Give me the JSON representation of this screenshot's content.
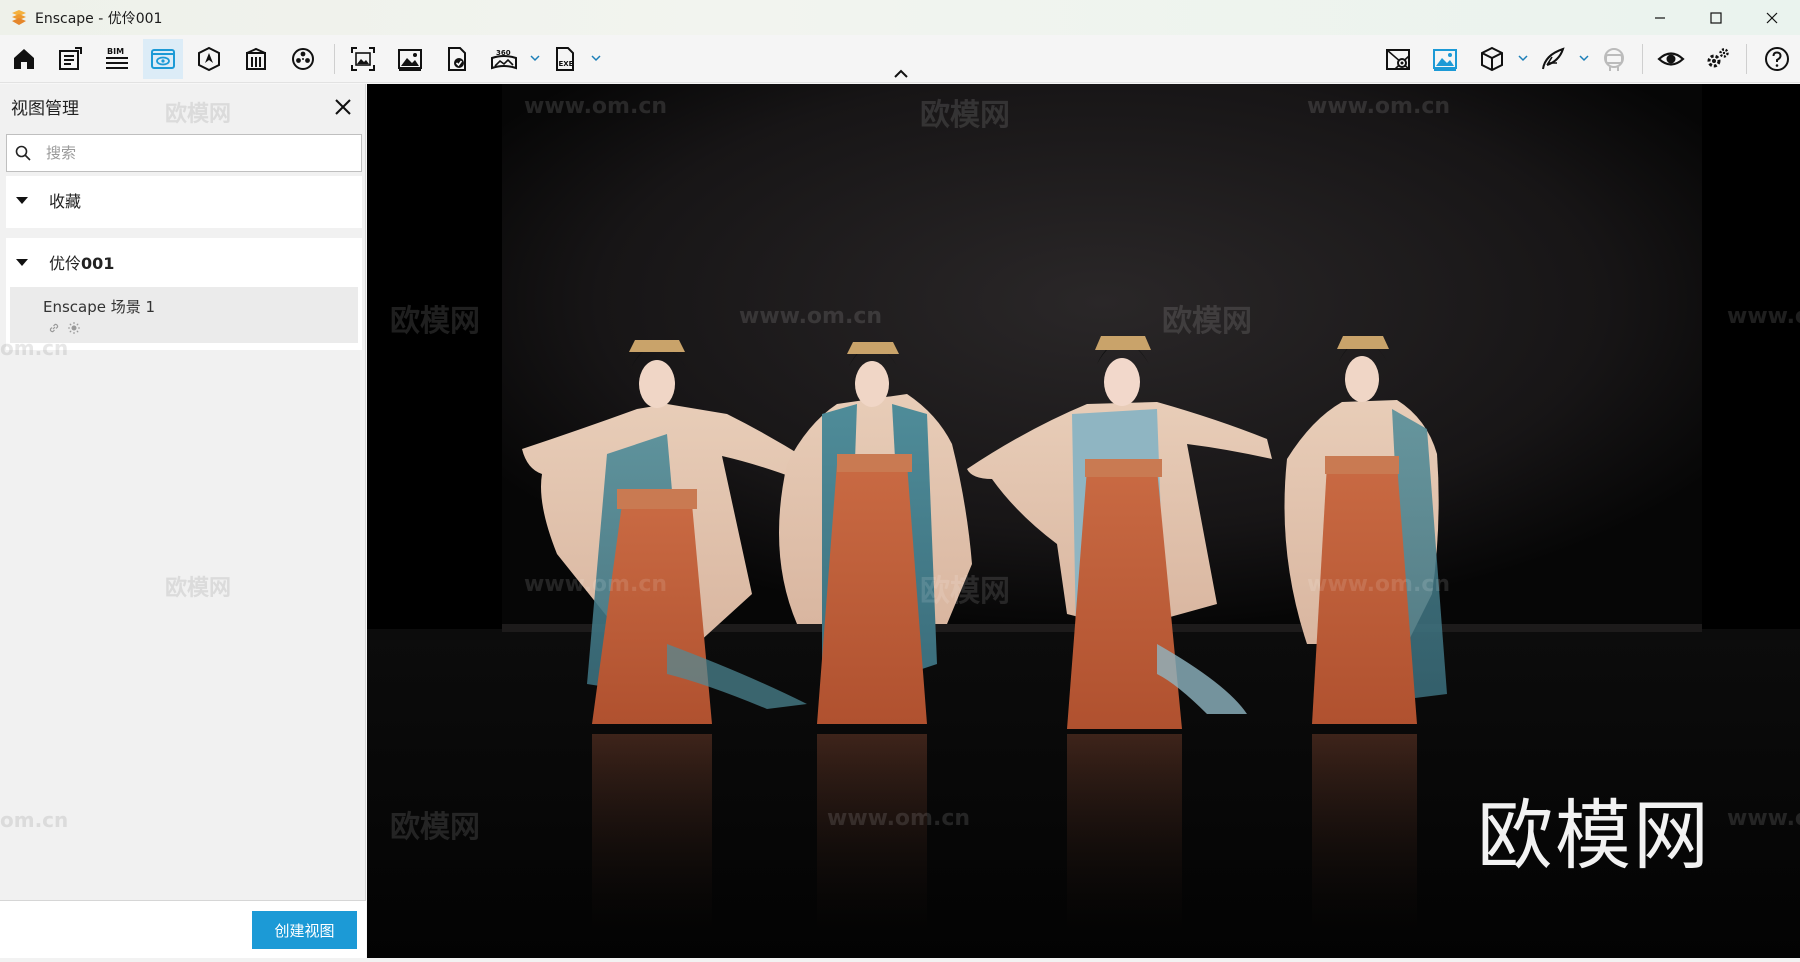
{
  "window": {
    "title": "Enscape - 优伶001",
    "logo_color": "#f0a23a"
  },
  "toolbar": {
    "left_icons": [
      "home-icon",
      "document-icon",
      "bim-icon",
      "view-management-icon",
      "navigation-icon",
      "building-icon",
      "video-reel-icon"
    ],
    "capture_icons": [
      "screenshot-icon",
      "image-icon",
      "export-file-icon",
      "panorama-360-icon",
      "exe-export-icon"
    ],
    "right_icons": [
      "map-pin-icon",
      "image-mode-icon",
      "cube-icon",
      "feather-icon",
      "vr-headset-icon",
      "eye-icon",
      "settings-icon",
      "help-icon"
    ],
    "bim_label": "BIM",
    "pano_label": "360",
    "exe_label": "EXE",
    "accent": "#1c9ad6",
    "active_bg": "#dcecf7"
  },
  "panel": {
    "title": "视图管理",
    "search_placeholder": "搜索",
    "favorites_label": "收藏",
    "project_label_prefix": "优伶",
    "project_label_suffix": "001",
    "view_item_label": "Enscape 场景 1",
    "create_button": "创建视图"
  },
  "watermarks": {
    "site_text": "www.om.cn",
    "brand_text": "欧模网",
    "partial_text": "om.cn",
    "partial_site": "www.o"
  }
}
